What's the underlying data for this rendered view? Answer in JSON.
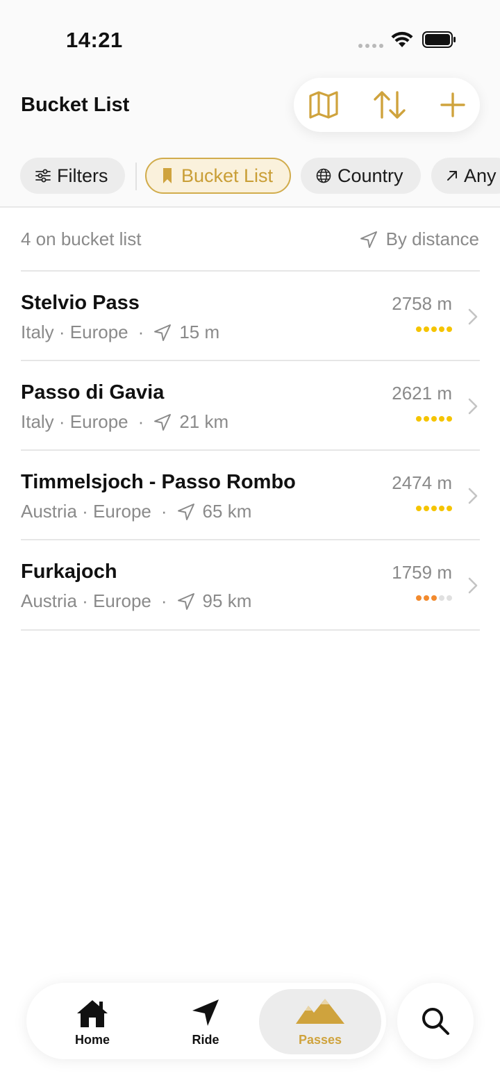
{
  "status_bar": {
    "time": "14:21"
  },
  "header": {
    "title": "Bucket List",
    "toolbar": {
      "map_icon": "map-icon",
      "sort_icon": "sort-arrows-icon",
      "add_icon": "plus-icon"
    }
  },
  "chips": {
    "filters": "Filters",
    "bucket_list": "Bucket List",
    "country": "Country",
    "any": "Any"
  },
  "list": {
    "count_label": "4 on bucket list",
    "sort_label": "By distance",
    "rows": [
      {
        "name": "Stelvio Pass",
        "region": "Italy · Europe",
        "distance": "15 m",
        "elevation": "2758 m",
        "rating": 5
      },
      {
        "name": "Passo di Gavia",
        "region": "Italy · Europe",
        "distance": "21 km",
        "elevation": "2621 m",
        "rating": 5
      },
      {
        "name": "Timmelsjoch - Passo Rombo",
        "region": "Austria · Europe",
        "distance": "65 km",
        "elevation": "2474 m",
        "rating": 5
      },
      {
        "name": "Furkajoch",
        "region": "Austria · Europe",
        "distance": "95 km",
        "elevation": "1759 m",
        "rating": 3
      }
    ]
  },
  "tabbar": {
    "home": "Home",
    "ride": "Ride",
    "passes": "Passes",
    "active": "passes"
  },
  "colors": {
    "accent": "#cfa33d",
    "rating_high": "#f5c400",
    "rating_mid": "#f28a2e"
  }
}
